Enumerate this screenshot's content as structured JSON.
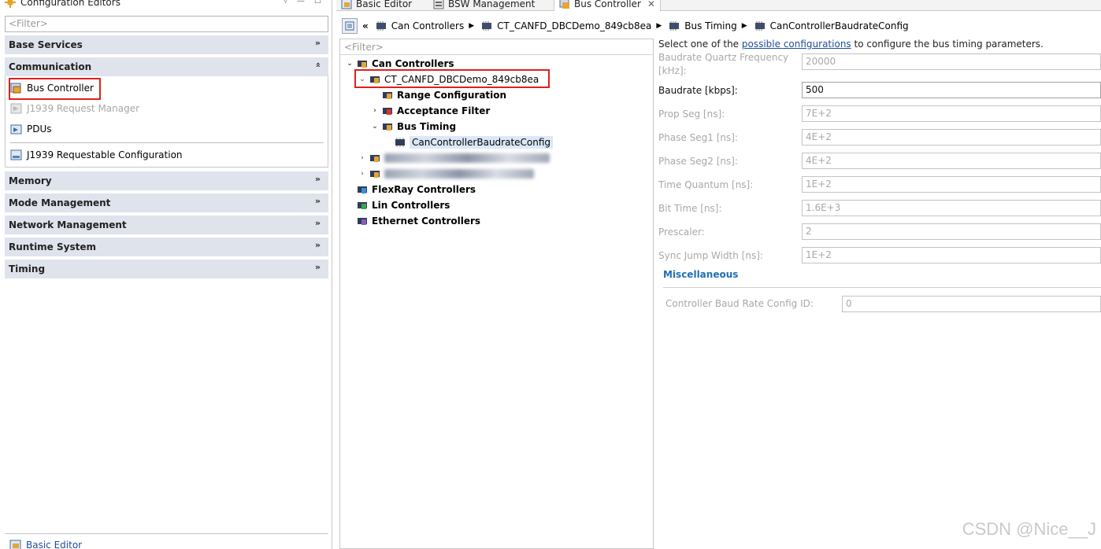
{
  "left_panel": {
    "title": "Configuration Editors",
    "filter_placeholder": "<Filter>",
    "sections": {
      "base_services": "Base Services",
      "communication": "Communication",
      "memory": "Memory",
      "mode_management": "Mode Management",
      "network_management": "Network Management",
      "runtime_system": "Runtime System",
      "timing": "Timing"
    },
    "communication_items": {
      "bus_controller": "Bus Controller",
      "j1939_request_manager": "J1939 Request Manager",
      "pdus": "PDUs",
      "j1939_requestable_config": "J1939 Requestable Configuration"
    },
    "bottom_link": "Basic Editor"
  },
  "tabs": {
    "basic_editor": "Basic Editor",
    "bsw_management": "BSW Management",
    "bus_controller": "Bus Controller"
  },
  "breadcrumb": {
    "back": "«",
    "sep": "▶",
    "item1": "Can Controllers",
    "item2": "CT_CANFD_DBCDemo_849cb8ea",
    "item3": "Bus Timing",
    "item4": "CanControllerBaudrateConfig"
  },
  "tree": {
    "filter_placeholder": "<Filter>",
    "can_controllers": "Can Controllers",
    "controller": "CT_CANFD_DBCDemo_849cb8ea",
    "range_configuration": "Range Configuration",
    "acceptance_filter": "Acceptance Filter",
    "bus_timing": "Bus Timing",
    "baudrate_config": "CanControllerBaudrateConfig",
    "flexray_controllers": "FlexRay Controllers",
    "lin_controllers": "Lin Controllers",
    "ethernet_controllers": "Ethernet Controllers"
  },
  "form": {
    "intro_prefix": "Select one of the ",
    "intro_link": "possible configurations",
    "intro_suffix": " to configure the bus timing parameters.",
    "fields": {
      "quartz_label_1": "Baudrate Quartz Frequency",
      "quartz_label_2": "[kHz]:",
      "quartz_value": "20000",
      "baudrate_label": "Baudrate [kbps]:",
      "baudrate_value": "500",
      "prop_seg_label": "Prop Seg [ns]:",
      "prop_seg_value": "7E+2",
      "phase_seg1_label": "Phase Seg1 [ns]:",
      "phase_seg1_value": "4E+2",
      "phase_seg2_label": "Phase Seg2 [ns]:",
      "phase_seg2_value": "4E+2",
      "time_quantum_label": "Time Quantum [ns]:",
      "time_quantum_value": "1E+2",
      "bit_time_label": "Bit Time [ns]:",
      "bit_time_value": "1.6E+3",
      "prescaler_label": "Prescaler:",
      "prescaler_value": "2",
      "sjw_label": "Sync Jump Width [ns]:",
      "sjw_value": "1E+2"
    },
    "misc_title": "Miscellaneous",
    "misc_label": "Controller Baud Rate Config ID:",
    "misc_value": "0"
  },
  "watermark": "CSDN @Nice__J",
  "colors": {
    "highlight": "#e0201c",
    "section_bg": "#dfe3ec",
    "link": "#1f4e9a"
  }
}
